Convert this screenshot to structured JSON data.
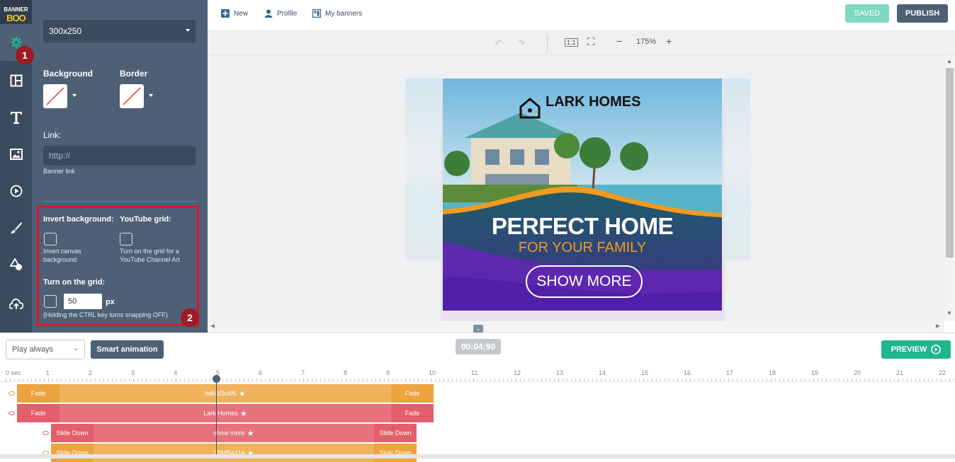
{
  "app": {
    "logo_top": "BANNER",
    "logo_bottom": "BOO"
  },
  "topbar": {
    "new": "New",
    "profile": "Profile",
    "my_banners": "My banners",
    "saved": "SAVED",
    "publish": "PUBLISH"
  },
  "zoom": {
    "level": "175%"
  },
  "panel": {
    "size": "300x250",
    "background_label": "Background",
    "border_label": "Border",
    "link_label": "Link:",
    "link_placeholder": "http://",
    "link_help": "Banner link",
    "invert_label": "Invert background:",
    "invert_help_1": "Invert canvas",
    "invert_help_2": "background",
    "youtube_label": "YouTube grid:",
    "youtube_help_1": "Turn on the grid for a",
    "youtube_help_2": "YouTube Channel Art",
    "grid_label": "Turn on the grid:",
    "grid_value": "50",
    "grid_unit": "px",
    "grid_help": "(Holding the CTRL key turns snapping OFF)"
  },
  "badges": {
    "one": "1",
    "two": "2"
  },
  "banner": {
    "brand": "LARK HOMES",
    "headline": "PERFECT HOME",
    "subline": "FOR YOUR FAMILY",
    "cta": "SHOW MORE"
  },
  "timeline": {
    "play_mode": "Play always",
    "smart_animation": "Smart animation",
    "time": "00:04:90",
    "preview": "PREVIEW",
    "ruler": [
      "0 sec",
      "1",
      "2",
      "3",
      "4",
      "5",
      "6",
      "7",
      "8",
      "9",
      "10",
      "11",
      "12",
      "13",
      "14",
      "15",
      "16",
      "17",
      "18",
      "19",
      "20",
      "21",
      "22"
    ],
    "tracks": [
      {
        "name": "bd66f3c4f5",
        "in": "Fade",
        "out": "Fade",
        "color": "#f0b25a",
        "edge": "#eda33e"
      },
      {
        "name": "Lark Homes",
        "in": "Fade",
        "out": "Fade",
        "color": "#e8727c",
        "edge": "#e35f6b"
      },
      {
        "name": "show more",
        "in": "Slide Down",
        "out": "Slide Down",
        "color": "#e8727c",
        "edge": "#e35f6b"
      },
      {
        "name": "3f9df5e11e",
        "in": "Slide Down",
        "out": "Slide Down",
        "color": "#f0b25a",
        "edge": "#eda33e"
      }
    ]
  },
  "icons": [
    "settings-icon",
    "layout-icon",
    "text-icon",
    "image-icon",
    "video-icon",
    "brush-icon",
    "shapes-icon",
    "upload-icon"
  ]
}
